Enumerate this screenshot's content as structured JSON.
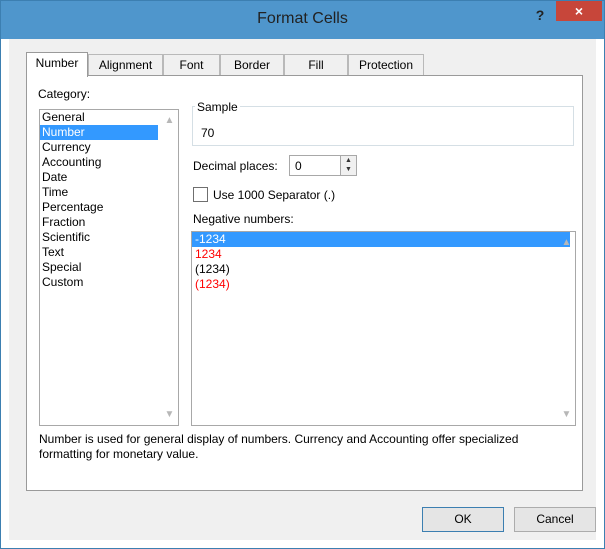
{
  "window": {
    "title": "Format Cells",
    "help_label": "?",
    "close_label": "×"
  },
  "tabs": [
    {
      "label": "Number",
      "active": true
    },
    {
      "label": "Alignment",
      "active": false
    },
    {
      "label": "Font",
      "active": false
    },
    {
      "label": "Border",
      "active": false
    },
    {
      "label": "Fill",
      "active": false
    },
    {
      "label": "Protection",
      "active": false
    }
  ],
  "category": {
    "label": "Category:",
    "items": [
      "General",
      "Number",
      "Currency",
      "Accounting",
      "Date",
      "Time",
      "Percentage",
      "Fraction",
      "Scientific",
      "Text",
      "Special",
      "Custom"
    ],
    "selected": "Number"
  },
  "sample": {
    "legend": "Sample",
    "value": "70"
  },
  "decimal_places": {
    "label": "Decimal places:",
    "value": "0"
  },
  "separator": {
    "label": "Use 1000 Separator (.)",
    "checked": false
  },
  "negative_numbers": {
    "label": "Negative numbers:",
    "items": [
      {
        "text": "-1234",
        "color": "#000000",
        "selected": true
      },
      {
        "text": "1234",
        "color": "#ff0000",
        "selected": false
      },
      {
        "text": "(1234)",
        "color": "#000000",
        "selected": false
      },
      {
        "text": "(1234)",
        "color": "#ff0000",
        "selected": false
      }
    ]
  },
  "description": "Number is used for general display of numbers.  Currency and Accounting offer specialized formatting for monetary value.",
  "buttons": {
    "ok": "OK",
    "cancel": "Cancel"
  },
  "colors": {
    "titlebar": "#4f96cc",
    "close": "#c7463a",
    "selection": "#3399ff",
    "negative_red": "#ff0000"
  }
}
